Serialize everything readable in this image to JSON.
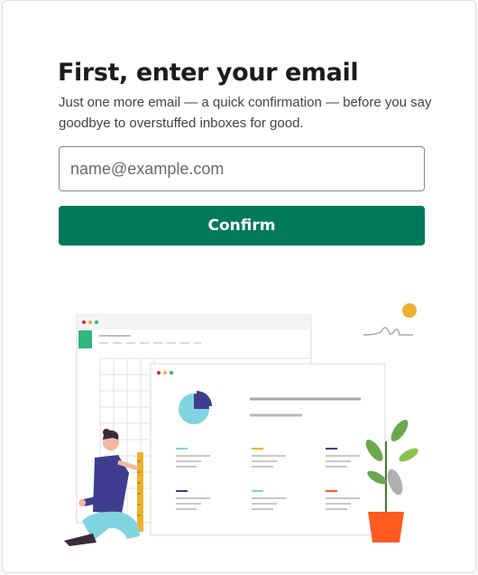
{
  "heading": "First, enter your email",
  "description": "Just one more email — a quick confirmation — before you say goodbye to overstuffed inboxes for good.",
  "email_input": {
    "value": "",
    "placeholder": "name@example.com"
  },
  "confirm_button": {
    "label": "Confirm"
  },
  "colors": {
    "brand_green": "#007a5a",
    "accent_yellow": "#ecb22e",
    "accent_teal": "#7fd4e0",
    "accent_purple": "#3f3d8f",
    "accent_orange": "#ff5a1f"
  },
  "illustration": {
    "icon": "email-dashboard-illustration"
  }
}
